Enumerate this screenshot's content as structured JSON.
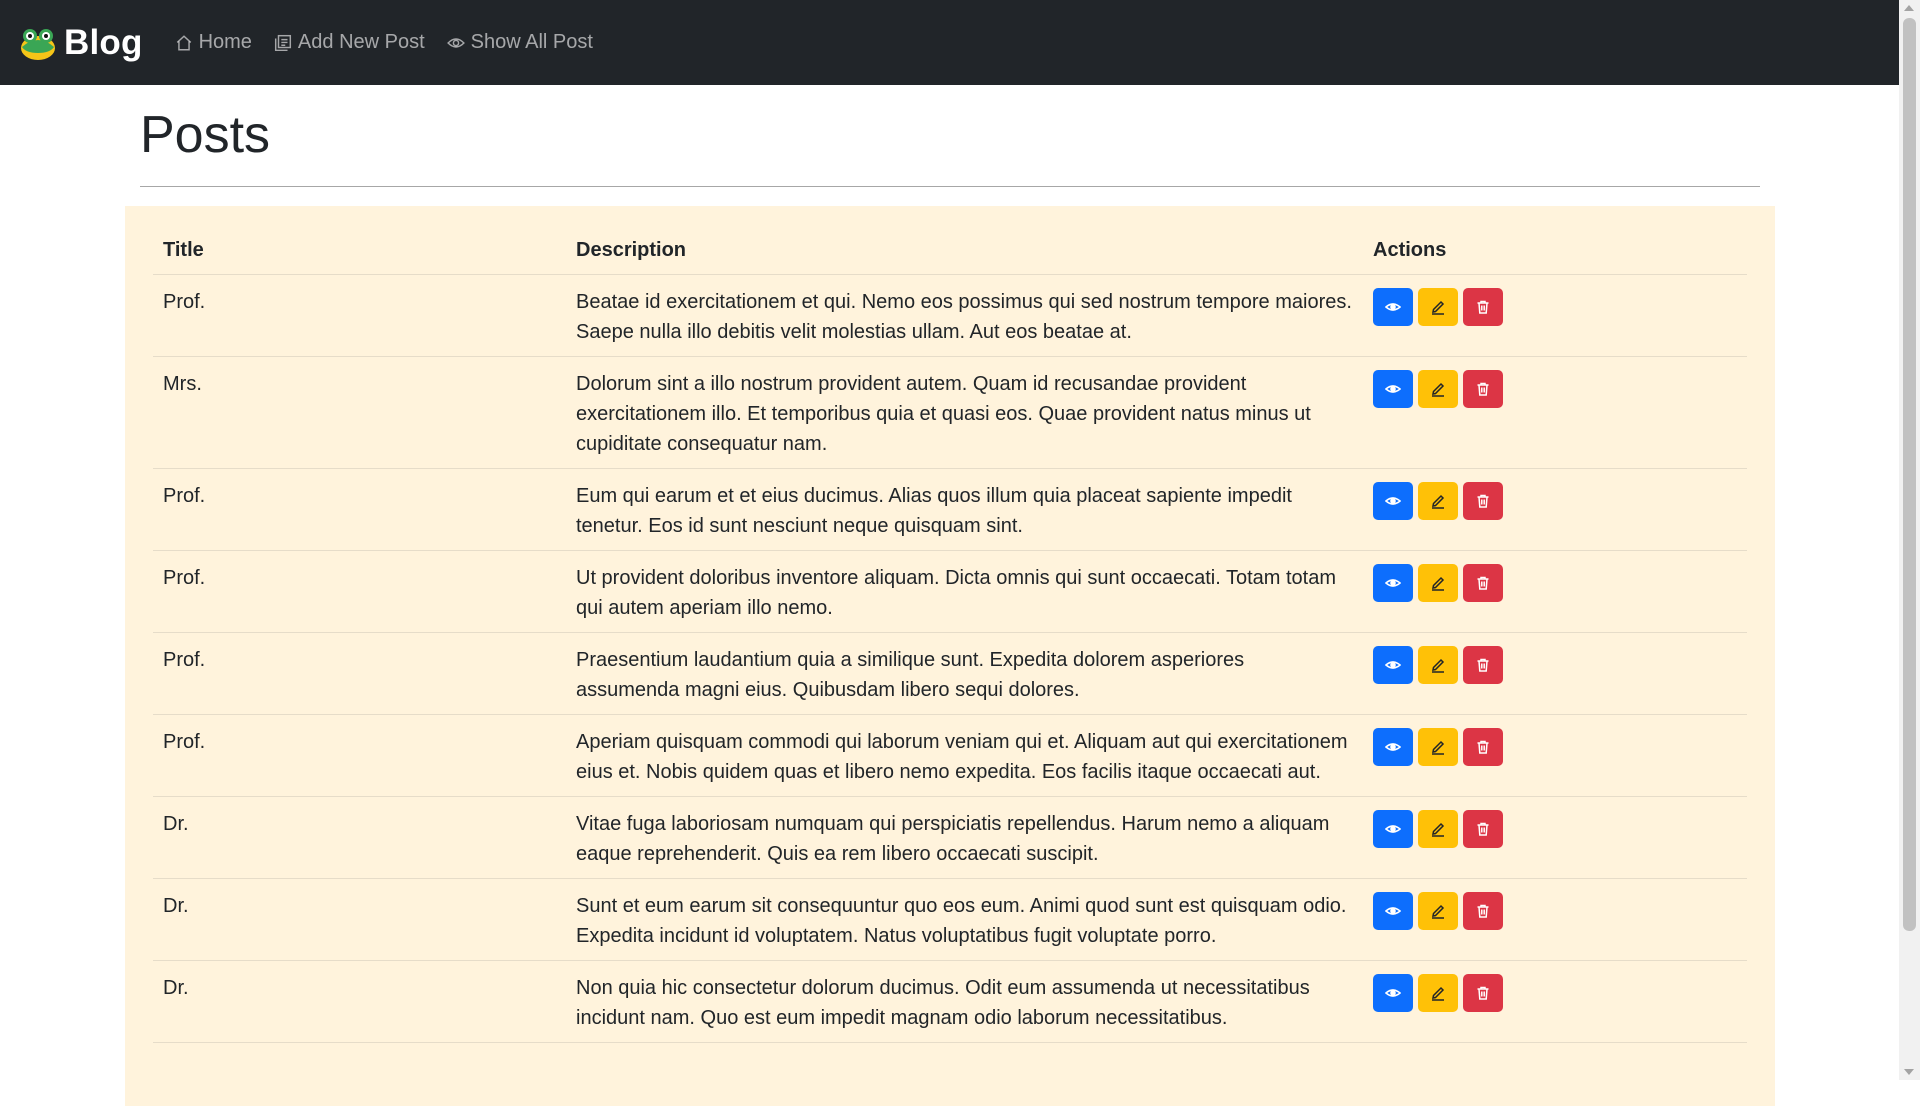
{
  "navbar": {
    "brand": "Blog",
    "links": [
      {
        "label": "Home",
        "icon": "home-icon"
      },
      {
        "label": "Add New Post",
        "icon": "add-post-icon"
      },
      {
        "label": "Show All Post",
        "icon": "eye-icon"
      }
    ]
  },
  "page": {
    "title": "Posts"
  },
  "table": {
    "headers": {
      "title": "Title",
      "description": "Description",
      "actions": "Actions"
    },
    "rows": [
      {
        "title": "Prof.",
        "description": "Beatae id exercitationem et qui. Nemo eos possimus qui sed nostrum tempore maiores. Saepe nulla illo debitis velit molestias ullam. Aut eos beatae at."
      },
      {
        "title": "Mrs.",
        "description": "Dolorum sint a illo nostrum provident autem. Quam id recusandae provident exercitationem illo. Et temporibus quia et quasi eos. Quae provident natus minus ut cupiditate consequatur nam."
      },
      {
        "title": "Prof.",
        "description": "Eum qui earum et et eius ducimus. Alias quos illum quia placeat sapiente impedit tenetur. Eos id sunt nesciunt neque quisquam sint."
      },
      {
        "title": "Prof.",
        "description": "Ut provident doloribus inventore aliquam. Dicta omnis qui sunt occaecati. Totam totam qui autem aperiam illo nemo."
      },
      {
        "title": "Prof.",
        "description": "Praesentium laudantium quia a similique sunt. Expedita dolorem asperiores assumenda magni eius. Quibusdam libero sequi dolores."
      },
      {
        "title": "Prof.",
        "description": "Aperiam quisquam commodi qui laborum veniam qui et. Aliquam aut qui exercitationem eius et. Nobis quidem quas et libero nemo expedita. Eos facilis itaque occaecati aut."
      },
      {
        "title": "Dr.",
        "description": "Vitae fuga laboriosam numquam qui perspiciatis repellendus. Harum nemo a aliquam eaque reprehenderit. Quis ea rem libero occaecati suscipit."
      },
      {
        "title": "Dr.",
        "description": "Sunt et eum earum sit consequuntur quo eos eum. Animi quod sunt est quisquam odio. Expedita incidunt id voluptatem. Natus voluptatibus fugit voluptate porro."
      },
      {
        "title": "Dr.",
        "description": "Non quia hic consectetur dolorum ducimus. Odit eum assumenda ut necessitatibus incidunt nam. Quo est eum impedit magnam odio laborum necessitatibus."
      }
    ]
  },
  "colors": {
    "view": "#0d6efd",
    "edit": "#ffc107",
    "delete": "#dc3545",
    "table_bg": "#fff3dc",
    "navbar_bg": "#212529"
  }
}
